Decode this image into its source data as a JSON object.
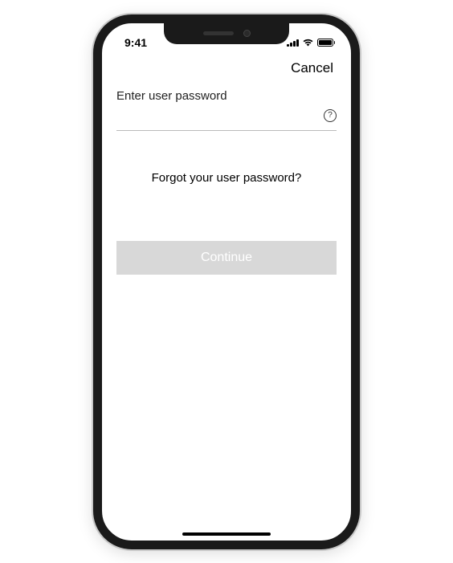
{
  "statusBar": {
    "time": "9:41"
  },
  "nav": {
    "cancel": "Cancel"
  },
  "form": {
    "label": "Enter user password",
    "helpSymbol": "?",
    "forgotLink": "Forgot your user password?",
    "continueLabel": "Continue"
  }
}
